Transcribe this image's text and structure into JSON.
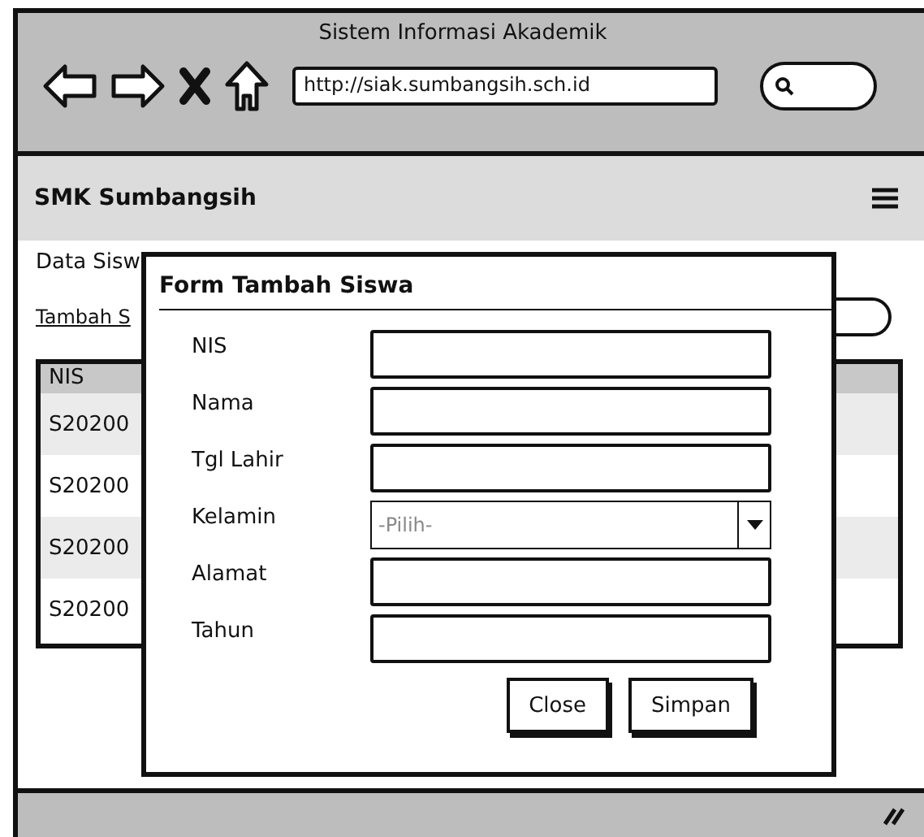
{
  "browser": {
    "title": "Sistem Informasi Akademik",
    "url": "http://siak.sumbangsih.sch.id"
  },
  "header": {
    "title": "SMK Sumbangsih"
  },
  "page": {
    "heading": "Data Sisw",
    "link": "Tambah S"
  },
  "table": {
    "columns": [
      "NIS"
    ],
    "rows": [
      [
        "S20200"
      ],
      [
        "S20200"
      ],
      [
        "S20200"
      ],
      [
        "S20200"
      ]
    ]
  },
  "dialog": {
    "title": "Form Tambah Siswa",
    "fields": [
      {
        "label": "NIS",
        "kind": "text"
      },
      {
        "label": "Nama",
        "kind": "text"
      },
      {
        "label": "Tgl Lahir",
        "kind": "text"
      },
      {
        "label": "Kelamin",
        "kind": "select",
        "placeholder": "-Pilih-"
      },
      {
        "label": "Alamat",
        "kind": "text"
      },
      {
        "label": "Tahun",
        "kind": "text"
      }
    ],
    "buttons": [
      "Close",
      "Simpan"
    ]
  }
}
